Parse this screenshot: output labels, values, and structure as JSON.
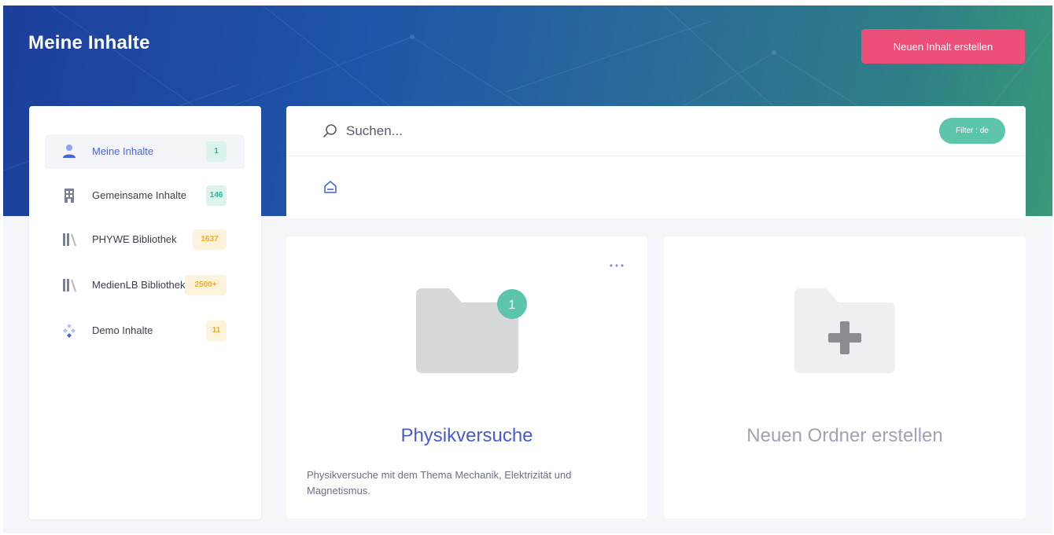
{
  "header": {
    "title": "Meine Inhalte",
    "new_content_button": "Neuen Inhalt erstellen"
  },
  "sidebar": {
    "items": [
      {
        "label": "Meine Inhalte",
        "count": "1",
        "icon": "user-icon",
        "active": true,
        "badge_color": "teal"
      },
      {
        "label": "Gemeinsame Inhalte",
        "count": "146",
        "icon": "building-icon",
        "active": false,
        "badge_color": "teal"
      },
      {
        "label": "PHYWE Bibliothek",
        "count": "1637",
        "icon": "library-icon",
        "active": false,
        "badge_color": "amber"
      },
      {
        "label": "MedienLB Bibliothek",
        "count": "2500+",
        "icon": "library-icon",
        "active": false,
        "badge_color": "amber"
      },
      {
        "label": "Demo Inhalte",
        "count": "11",
        "icon": "shapes-icon",
        "active": false,
        "badge_color": "amber"
      }
    ]
  },
  "search": {
    "placeholder": "Suchen...",
    "filter_label": "Filter : de"
  },
  "breadcrumb": {
    "icon": "home-icon"
  },
  "folders": [
    {
      "title": "Physikversuche",
      "description": "Physikversuche mit dem Thema Mechanik, Elektrizität und Magnetismus.",
      "count_badge": "1",
      "icon": "folder-icon"
    }
  ],
  "new_folder": {
    "label": "Neuen Ordner erstellen",
    "icon": "folder-plus-icon"
  },
  "colors": {
    "accent_pink": "#ec4f77",
    "accent_teal": "#5dc5a9",
    "accent_blue": "#4a5bd0",
    "hero_start": "#1d3f9c",
    "hero_end": "#399a78"
  }
}
